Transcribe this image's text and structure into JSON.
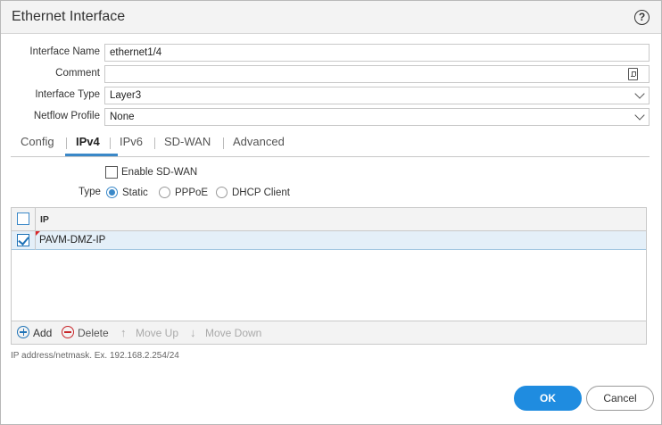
{
  "dialog": {
    "title": "Ethernet Interface",
    "help_label": "?"
  },
  "form": {
    "interface_name_label": "Interface Name",
    "interface_name_value": "ethernet1/4",
    "comment_label": "Comment",
    "comment_value": "",
    "interface_type_label": "Interface Type",
    "interface_type_value": "Layer3",
    "netflow_profile_label": "Netflow Profile",
    "netflow_profile_value": "None"
  },
  "tabs": [
    {
      "label": "Config",
      "active": false
    },
    {
      "label": "IPv4",
      "active": true
    },
    {
      "label": "IPv6",
      "active": false
    },
    {
      "label": "SD-WAN",
      "active": false
    },
    {
      "label": "Advanced",
      "active": false
    }
  ],
  "ipv4": {
    "enable_sdwan_label": "Enable SD-WAN",
    "enable_sdwan_checked": false,
    "type_label": "Type",
    "type_options": [
      "Static",
      "PPPoE",
      "DHCP Client"
    ],
    "type_selected": "Static"
  },
  "ip_table": {
    "column_header": "IP",
    "rows": [
      {
        "value": "PAVM-DMZ-IP",
        "checked": true
      }
    ]
  },
  "toolbar": {
    "add_label": "Add",
    "delete_label": "Delete",
    "move_up_label": "Move Up",
    "move_down_label": "Move Down"
  },
  "hint_text": "IP address/netmask. Ex. 192.168.2.254/24",
  "buttons": {
    "ok_label": "OK",
    "cancel_label": "Cancel"
  },
  "colors": {
    "accent": "#1f8ce0",
    "selected_row": "#e4eff8",
    "delete_red": "#c8262a"
  }
}
